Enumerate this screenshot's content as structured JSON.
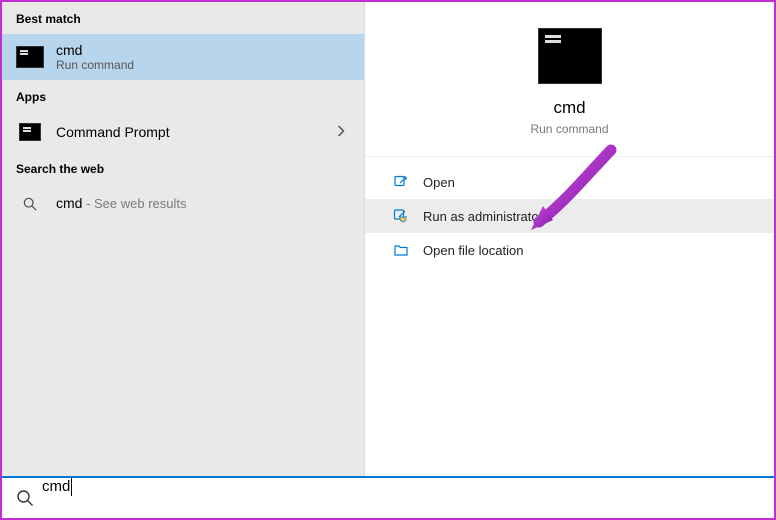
{
  "left": {
    "best_match_header": "Best match",
    "best_match_title": "cmd",
    "best_match_subtitle": "Run command",
    "apps_header": "Apps",
    "apps_item": "Command Prompt",
    "web_header": "Search the web",
    "web_title": "cmd",
    "web_desc": " - See web results"
  },
  "detail": {
    "title": "cmd",
    "subtitle": "Run command",
    "actions": [
      {
        "label": "Open",
        "icon": "open"
      },
      {
        "label": "Run as administrator",
        "icon": "admin"
      },
      {
        "label": "Open file location",
        "icon": "folder"
      }
    ]
  },
  "search": {
    "value": "cmd"
  },
  "colors": {
    "accent": "#0078d4",
    "arrow": "#9b2fae"
  }
}
